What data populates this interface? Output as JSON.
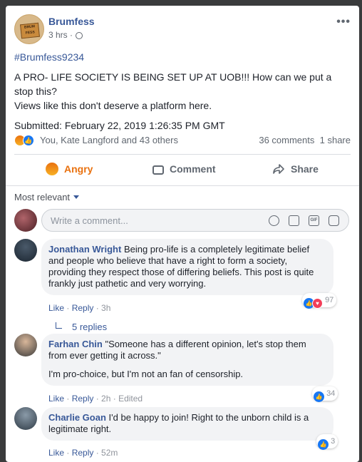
{
  "post": {
    "page_name": "Brumfess",
    "page_avatar_text": "Brum\nFess",
    "time": "3 hrs",
    "dot": "·",
    "privacy_icon": "globe-icon",
    "more_icon": "•••",
    "hashtag": "#Brumfess9234",
    "body_line1": "A PRO- LIFE SOCIETY IS BEING SET UP AT UOB!!! How can we put a stop this?",
    "body_line2": "Views like this don't deserve a platform here.",
    "submitted": "Submitted: February 22, 2019 1:26:35 PM GMT"
  },
  "reactions": {
    "names": "You, Kate Langford and 43 others",
    "comments": "36 comments",
    "shares": "1 share"
  },
  "actions": {
    "angry": "Angry",
    "comment": "Comment",
    "share": "Share"
  },
  "comments_section": {
    "sort_label": "Most relevant",
    "input_placeholder": "Write a comment..."
  },
  "comments": [
    {
      "author": "Jonathan Wright",
      "text": "Being pro-life is a completely legitimate belief and people who believe that have a right to form a society, providing they respect those of differing beliefs. This post is quite frankly just pathetic and very worrying.",
      "like": "Like",
      "reply": "Reply",
      "time": "3h",
      "reaction_count": "97",
      "replies": "5 replies"
    },
    {
      "author": "Farhan Chin",
      "text": "\"Someone has a different opinion, let's stop them from ever getting it across.\"",
      "text2": "I'm pro-choice, but I'm not an fan of censorship.",
      "like": "Like",
      "reply": "Reply",
      "time": "2h",
      "edited": "Edited",
      "reaction_count": "34"
    },
    {
      "author": "Charlie Goan",
      "text": "I'd be happy to join! Right to the unborn child is a legitimate right.",
      "like": "Like",
      "reply": "Reply",
      "time": "52m",
      "reaction_count": "3"
    }
  ],
  "colors": {
    "link": "#385898",
    "angry": "#e9710f",
    "like": "#1877f2",
    "love": "#f33e58"
  }
}
